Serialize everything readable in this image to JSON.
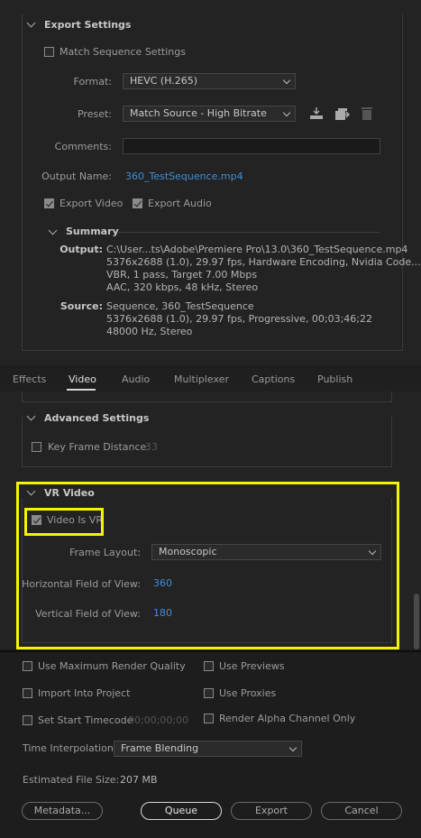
{
  "export_settings": {
    "title": "Export Settings",
    "match_sequence_label": "Match Sequence Settings",
    "format_label": "Format:",
    "format_value": "HEVC (H.265)",
    "preset_label": "Preset:",
    "preset_value": "Match Source - High Bitrate",
    "comments_label": "Comments:",
    "output_name_label": "Output Name:",
    "output_name_value": "360_TestSequence.mp4",
    "export_video_label": "Export Video",
    "export_audio_label": "Export Audio"
  },
  "summary": {
    "title": "Summary",
    "output_label": "Output:",
    "output_lines": [
      "C:\\User...ts\\Adobe\\Premiere Pro\\13.0\\360_TestSequence.mp4",
      "5376x2688 (1.0), 29.97 fps, Hardware Encoding, Nvidia Code...",
      "VBR, 1 pass, Target 7.00 Mbps",
      "AAC, 320 kbps, 48 kHz, Stereo"
    ],
    "source_label": "Source:",
    "source_lines": [
      "Sequence, 360_TestSequence",
      "5376x2688 (1.0), 29.97 fps, Progressive, 00;03;46;22",
      "48000 Hz, Stereo"
    ]
  },
  "tabs": [
    "Effects",
    "Video",
    "Audio",
    "Multiplexer",
    "Captions",
    "Publish"
  ],
  "advanced": {
    "title": "Advanced Settings",
    "key_frame_label": "Key Frame Distance:",
    "key_frame_value": "33"
  },
  "vr": {
    "title": "VR Video",
    "video_is_vr_label": "Video Is VR",
    "frame_layout_label": "Frame Layout:",
    "frame_layout_value": "Monoscopic",
    "hfov_label": "Horizontal Field of View:",
    "hfov_value": "360",
    "vfov_label": "Vertical Field of View:",
    "vfov_value": "180"
  },
  "bottom": {
    "max_render_quality": "Use Maximum Render Quality",
    "use_previews": "Use Previews",
    "import_into_project": "Import Into Project",
    "use_proxies": "Use Proxies",
    "set_start_timecode": "Set Start Timecode",
    "start_timecode_value": "00;00;00;00",
    "render_alpha": "Render Alpha Channel Only",
    "time_interp_label": "Time Interpolation:",
    "time_interp_value": "Frame Blending",
    "file_size_label": "Estimated File Size:",
    "file_size_value": "207 MB"
  },
  "buttons": {
    "metadata": "Metadata...",
    "queue": "Queue",
    "export": "Export",
    "cancel": "Cancel"
  },
  "colors": {
    "highlight": "#f5f500",
    "link": "#3d8fdb"
  },
  "icons": [
    "import-preset-icon",
    "save-preset-icon",
    "delete-preset-icon"
  ]
}
